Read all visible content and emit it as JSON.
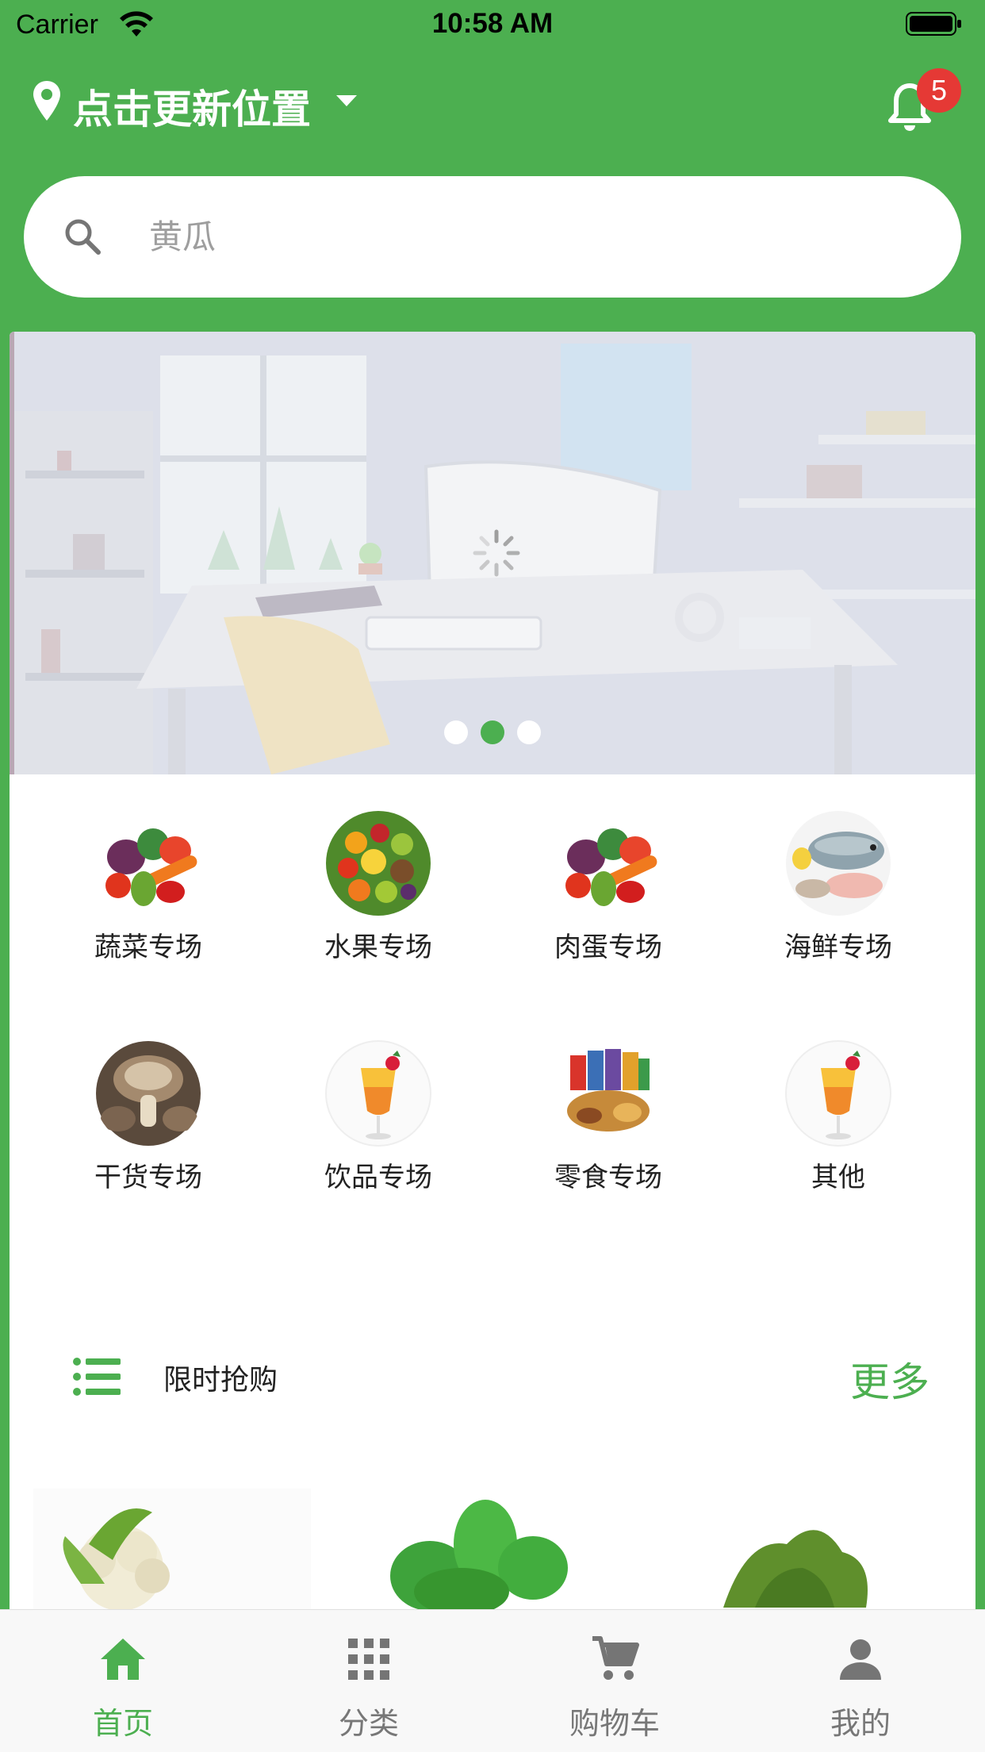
{
  "status_bar": {
    "carrier": "Carrier",
    "time": "10:58 AM"
  },
  "header": {
    "location_label": "点击更新位置",
    "notification_count": "5"
  },
  "search": {
    "placeholder": "黄瓜",
    "value": ""
  },
  "banner": {
    "active_index": 1,
    "slide_count": 3
  },
  "categories": [
    {
      "label": "蔬菜专场",
      "icon": "vegetables-image"
    },
    {
      "label": "水果专场",
      "icon": "fruits-image"
    },
    {
      "label": "肉蛋专场",
      "icon": "vegetables-image"
    },
    {
      "label": "海鲜专场",
      "icon": "seafood-image"
    },
    {
      "label": "干货专场",
      "icon": "mushroom-image"
    },
    {
      "label": "饮品专场",
      "icon": "drink-image"
    },
    {
      "label": "零食专场",
      "icon": "snacks-image"
    },
    {
      "label": "其他",
      "icon": "drink-image"
    }
  ],
  "flash_sale": {
    "title": "限时抢购",
    "more": "更多",
    "products": [
      {
        "icon": "cauliflower-image"
      },
      {
        "icon": "spinach-image"
      },
      {
        "icon": "greens-image"
      }
    ]
  },
  "tabbar": {
    "items": [
      {
        "label": "首页",
        "icon": "home-icon",
        "active": true
      },
      {
        "label": "分类",
        "icon": "grid-icon",
        "active": false
      },
      {
        "label": "购物车",
        "icon": "cart-icon",
        "active": false
      },
      {
        "label": "我的",
        "icon": "person-icon",
        "active": false
      }
    ]
  },
  "colors": {
    "brand_green": "#4caf50",
    "badge_red": "#e53935",
    "tab_inactive": "#777777"
  }
}
